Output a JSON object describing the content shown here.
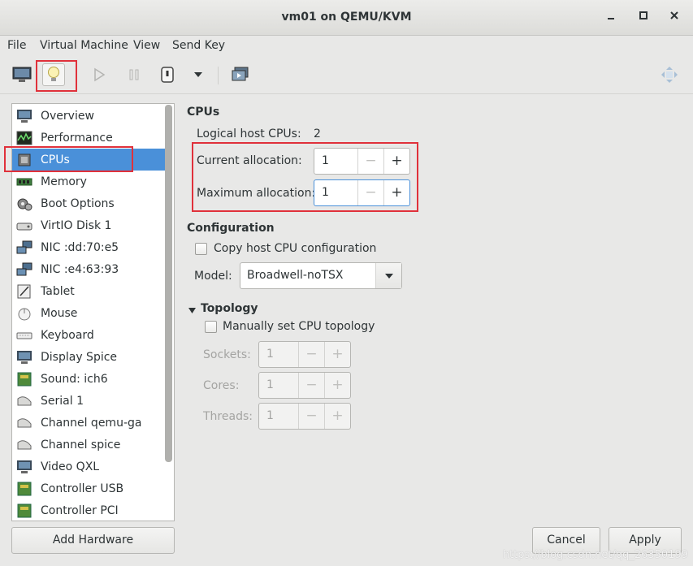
{
  "window": {
    "title": "vm01 on QEMU/KVM",
    "min_icon": "minimize-icon",
    "max_icon": "maximize-icon",
    "close_icon": "close-icon"
  },
  "menu": [
    "File",
    "Virtual Machine",
    "View",
    "Send Key"
  ],
  "toolbar": {
    "icons": [
      "monitor-icon",
      "lightbulb-icon",
      "play-icon",
      "pause-icon",
      "power-icon",
      "dropdown-arrow-icon",
      "screenshot-icon",
      "fullscreen-icon"
    ]
  },
  "sidebar": {
    "items": [
      {
        "label": "Overview",
        "icon": "overview-icon"
      },
      {
        "label": "Performance",
        "icon": "performance-icon"
      },
      {
        "label": "CPUs",
        "icon": "cpu-icon"
      },
      {
        "label": "Memory",
        "icon": "memory-icon"
      },
      {
        "label": "Boot Options",
        "icon": "boot-options-icon"
      },
      {
        "label": "VirtIO Disk 1",
        "icon": "disk-icon"
      },
      {
        "label": "NIC :dd:70:e5",
        "icon": "nic-icon"
      },
      {
        "label": "NIC :e4:63:93",
        "icon": "nic-icon"
      },
      {
        "label": "Tablet",
        "icon": "tablet-icon"
      },
      {
        "label": "Mouse",
        "icon": "mouse-icon"
      },
      {
        "label": "Keyboard",
        "icon": "keyboard-icon"
      },
      {
        "label": "Display Spice",
        "icon": "display-icon"
      },
      {
        "label": "Sound: ich6",
        "icon": "sound-icon"
      },
      {
        "label": "Serial 1",
        "icon": "serial-icon"
      },
      {
        "label": "Channel qemu-ga",
        "icon": "channel-icon"
      },
      {
        "label": "Channel spice",
        "icon": "channel-icon"
      },
      {
        "label": "Video QXL",
        "icon": "video-icon"
      },
      {
        "label": "Controller USB",
        "icon": "controller-icon"
      },
      {
        "label": "Controller PCI",
        "icon": "controller-icon"
      }
    ],
    "selected": "CPUs"
  },
  "add_hardware": "Add Hardware",
  "cpus": {
    "heading": "CPUs",
    "logical_label": "Logical host CPUs:",
    "logical_value": "2",
    "current_label": "Current allocation:",
    "current_value": "1",
    "maximum_label": "Maximum allocation:",
    "maximum_value": "1",
    "minus": "−",
    "plus": "+"
  },
  "configuration": {
    "heading": "Configuration",
    "copy_host_label": "Copy host CPU configuration",
    "model_label": "Model:",
    "model_value": "Broadwell-noTSX"
  },
  "topology": {
    "heading": "Topology",
    "manual_label": "Manually set CPU topology",
    "sockets_label": "Sockets:",
    "sockets_value": "1",
    "cores_label": "Cores:",
    "cores_value": "1",
    "threads_label": "Threads:",
    "threads_value": "1"
  },
  "buttons": {
    "cancel": "Cancel",
    "apply": "Apply"
  },
  "watermark": "https://blog.csdn.net/qq_26350199",
  "colors": {
    "selection": "#4a90d9",
    "highlight_box": "#e0313b"
  }
}
